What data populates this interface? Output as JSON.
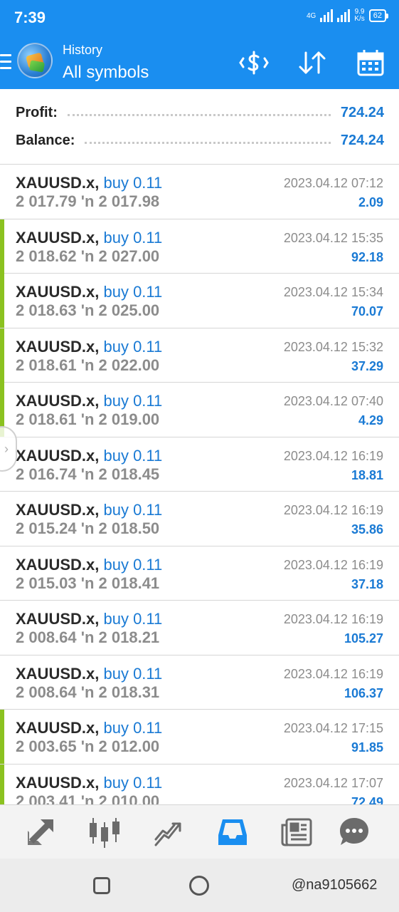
{
  "status_bar": {
    "time": "7:39",
    "network": "4G",
    "speed_value": "9.9",
    "speed_unit": "K/s",
    "battery": "62"
  },
  "header": {
    "subtitle": "History",
    "title": "All symbols",
    "icons": [
      "menu-icon",
      "dollar-exchange-icon",
      "sort-icon",
      "calendar-icon"
    ]
  },
  "summary": {
    "profit_label": "Profit:",
    "profit_value": "724.24",
    "balance_label": "Balance:",
    "balance_value": "724.24"
  },
  "deals": [
    {
      "symbol": "XAUUSD.x,",
      "type": "buy 0.11",
      "prices": "2 017.79 'n  2 017.98",
      "date": "2023.04.12 07:12",
      "profit": "2.09",
      "tagged": false
    },
    {
      "symbol": "XAUUSD.x,",
      "type": "buy 0.11",
      "prices": "2 018.62 'n  2 027.00",
      "date": "2023.04.12 15:35",
      "profit": "92.18",
      "tagged": true
    },
    {
      "symbol": "XAUUSD.x,",
      "type": "buy 0.11",
      "prices": "2 018.63 'n  2 025.00",
      "date": "2023.04.12 15:34",
      "profit": "70.07",
      "tagged": true
    },
    {
      "symbol": "XAUUSD.x,",
      "type": "buy 0.11",
      "prices": "2 018.61 'n  2 022.00",
      "date": "2023.04.12 15:32",
      "profit": "37.29",
      "tagged": true
    },
    {
      "symbol": "XAUUSD.x,",
      "type": "buy 0.11",
      "prices": "2 018.61 'n  2 019.00",
      "date": "2023.04.12 07:40",
      "profit": "4.29",
      "tagged": true
    },
    {
      "symbol": "XAUUSD.x,",
      "type": "buy 0.11",
      "prices": "2 016.74 'n  2 018.45",
      "date": "2023.04.12 16:19",
      "profit": "18.81",
      "tagged": false
    },
    {
      "symbol": "XAUUSD.x,",
      "type": "buy 0.11",
      "prices": "2 015.24 'n  2 018.50",
      "date": "2023.04.12 16:19",
      "profit": "35.86",
      "tagged": false
    },
    {
      "symbol": "XAUUSD.x,",
      "type": "buy 0.11",
      "prices": "2 015.03 'n  2 018.41",
      "date": "2023.04.12 16:19",
      "profit": "37.18",
      "tagged": false
    },
    {
      "symbol": "XAUUSD.x,",
      "type": "buy 0.11",
      "prices": "2 008.64 'n  2 018.21",
      "date": "2023.04.12 16:19",
      "profit": "105.27",
      "tagged": false
    },
    {
      "symbol": "XAUUSD.x,",
      "type": "buy 0.11",
      "prices": "2 008.64 'n  2 018.31",
      "date": "2023.04.12 16:19",
      "profit": "106.37",
      "tagged": false
    },
    {
      "symbol": "XAUUSD.x,",
      "type": "buy 0.11",
      "prices": "2 003.65 'n  2 012.00",
      "date": "2023.04.12 17:15",
      "profit": "91.85",
      "tagged": true
    },
    {
      "symbol": "XAUUSD.x,",
      "type": "buy 0.11",
      "prices": "2 003.41 'n  2 010.00",
      "date": "2023.04.12 17:07",
      "profit": "72.49",
      "tagged": true
    }
  ],
  "bottom_nav": {
    "items": [
      "quotes-icon",
      "chart-icon",
      "trade-icon",
      "history-icon",
      "news-icon",
      "chat-icon"
    ],
    "active_color": "#1a8ef0",
    "inactive_color": "#6b6b6b"
  },
  "watermark": "@na9105662",
  "colors": {
    "header_blue": "#1a8ef0",
    "value_blue": "#1a7ad4",
    "tag_green": "#8bc220"
  }
}
